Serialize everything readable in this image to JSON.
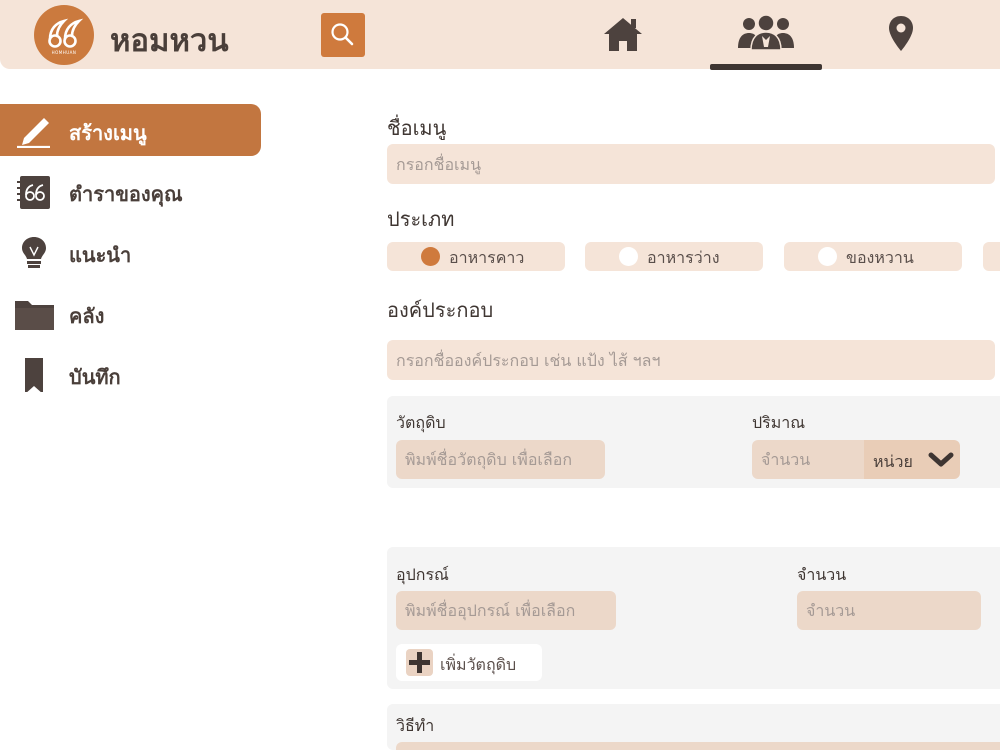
{
  "header": {
    "brand": "หอมหวน",
    "logo_subtext": "HOMHUAN",
    "icons": {
      "logo": "leaf-swirl-logo",
      "search": "search-icon",
      "home": "home-icon",
      "community": "group-icon",
      "location": "location-pin-icon"
    },
    "active_nav": "community"
  },
  "sidebar": {
    "items": [
      {
        "label": "สร้างเมนู",
        "icon": "pen-icon",
        "active": true
      },
      {
        "label": "ตำราของคุณ",
        "icon": "recipe-book-icon",
        "active": false
      },
      {
        "label": "แนะนำ",
        "icon": "lightbulb-icon",
        "active": false
      },
      {
        "label": "คลัง",
        "icon": "folder-icon",
        "active": false
      },
      {
        "label": "บันทึก",
        "icon": "bookmark-icon",
        "active": false
      }
    ]
  },
  "form": {
    "menu_name": {
      "label": "ชื่อเมนู",
      "placeholder": "กรอกชื่อเมนู",
      "value": ""
    },
    "category": {
      "label": "ประเภท",
      "options": [
        {
          "label": "อาหารคาว",
          "selected": true
        },
        {
          "label": "อาหารว่าง",
          "selected": false
        },
        {
          "label": "ของหวาน",
          "selected": false
        }
      ]
    },
    "components": {
      "label": "องค์ประกอบ",
      "placeholder": "กรอกชื่อองค์ประกอบ เช่น แป้ง ไส้ ฯลฯ",
      "value": ""
    },
    "ingredient": {
      "label": "วัตถุดิบ",
      "placeholder": "พิมพ์ชื่อวัตถุดิบ เพื่อเลือก",
      "quantity_label": "ปริมาณ",
      "quantity_placeholder": "จำนวน",
      "unit_label": "หน่วย"
    },
    "equipment": {
      "label": "อุปกรณ์",
      "placeholder": "พิมพ์ชื่ออุปกรณ์ เพื่อเลือก",
      "count_label": "จำนวน",
      "count_placeholder": "จำนวน",
      "add_button": "เพิ่มวัตถุดิบ"
    },
    "method": {
      "label": "วิธีทำ"
    }
  },
  "colors": {
    "accent": "#cf7a3d",
    "active_sidebar": "#c27640",
    "header_bg": "#f5e4d8",
    "field_bg": "#f5e4d8",
    "panel_bg": "#f4f4f4",
    "text_dark": "#3f3632"
  }
}
